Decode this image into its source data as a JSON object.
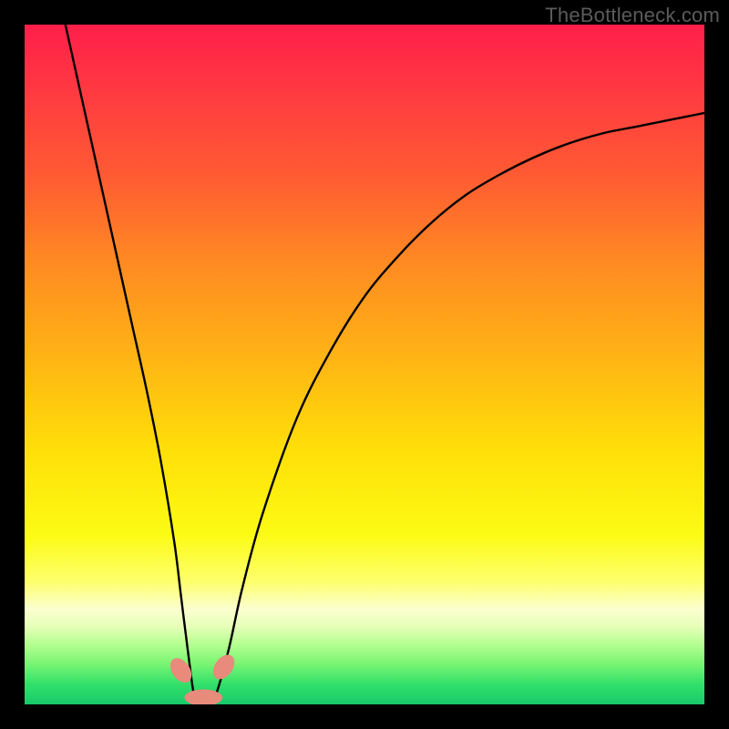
{
  "watermark": "TheBottleneck.com",
  "chart_data": {
    "type": "line",
    "title": "",
    "xlabel": "",
    "ylabel": "",
    "xlim": [
      0,
      100
    ],
    "ylim": [
      0,
      100
    ],
    "grid": false,
    "legend": false,
    "annotations": [],
    "series": [
      {
        "name": "bottleneck-curve",
        "x": [
          6,
          8,
          10,
          12,
          14,
          16,
          18,
          20,
          22,
          23,
          24,
          25,
          26,
          27,
          28,
          30,
          32,
          35,
          40,
          45,
          50,
          55,
          60,
          65,
          70,
          75,
          80,
          85,
          90,
          95,
          100
        ],
        "y": [
          100,
          91,
          82,
          73,
          64,
          55,
          46,
          36,
          24,
          16,
          8,
          1,
          0,
          0,
          1,
          8,
          17,
          28,
          42,
          52,
          60,
          66,
          71,
          75,
          78,
          80.5,
          82.5,
          84,
          85,
          86,
          87
        ]
      }
    ],
    "markers": [
      {
        "name": "marker-left-guide",
        "cx": 23.0,
        "cy": 5.0,
        "rx": 1.3,
        "ry": 2.0,
        "angle": -35
      },
      {
        "name": "marker-right-guide",
        "cx": 29.3,
        "cy": 5.5,
        "rx": 1.3,
        "ry": 2.0,
        "angle": 35
      },
      {
        "name": "marker-bottom-pill",
        "cx": 26.3,
        "cy": 1.0,
        "rx": 2.8,
        "ry": 1.2,
        "angle": 0
      }
    ],
    "background_gradient": {
      "stops": [
        {
          "offset": 0.0,
          "color": "#ff1f4a"
        },
        {
          "offset": 0.1,
          "color": "#ff3a41"
        },
        {
          "offset": 0.22,
          "color": "#ff5a33"
        },
        {
          "offset": 0.35,
          "color": "#ff8a22"
        },
        {
          "offset": 0.5,
          "color": "#ffb714"
        },
        {
          "offset": 0.63,
          "color": "#ffe009"
        },
        {
          "offset": 0.75,
          "color": "#fcfb14"
        },
        {
          "offset": 0.82,
          "color": "#feff6e"
        },
        {
          "offset": 0.86,
          "color": "#fbffd0"
        },
        {
          "offset": 0.885,
          "color": "#e7ffb9"
        },
        {
          "offset": 0.91,
          "color": "#b8ff93"
        },
        {
          "offset": 0.94,
          "color": "#7af573"
        },
        {
          "offset": 0.97,
          "color": "#33e06a"
        },
        {
          "offset": 1.0,
          "color": "#18c96a"
        }
      ]
    }
  }
}
